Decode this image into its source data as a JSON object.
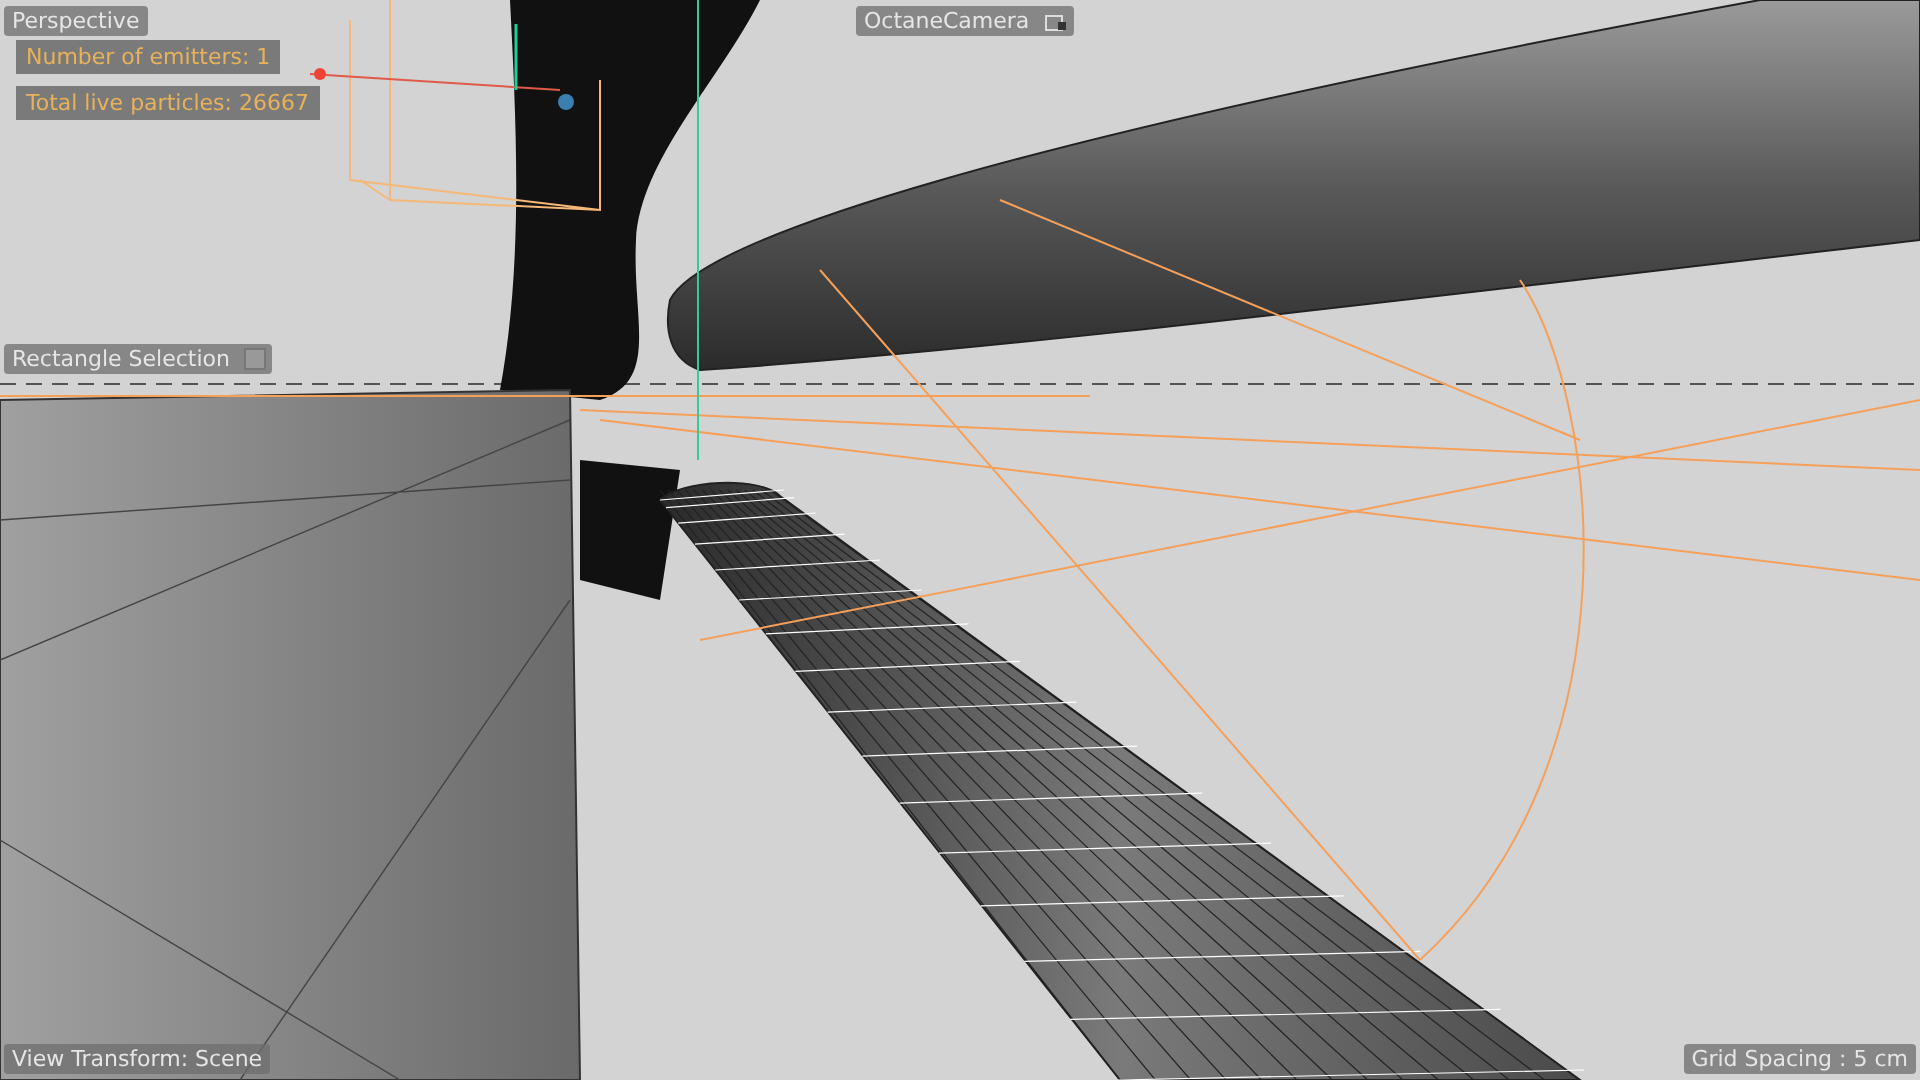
{
  "viewport": {
    "name": "Perspective",
    "camera": "OctaneCamera",
    "hud": [
      "Number of emitters: 1",
      "Total live particles: 26667"
    ],
    "tool": "Rectangle Selection",
    "view_transform": "View Transform: Scene",
    "grid_spacing": "Grid Spacing : 5 cm"
  }
}
